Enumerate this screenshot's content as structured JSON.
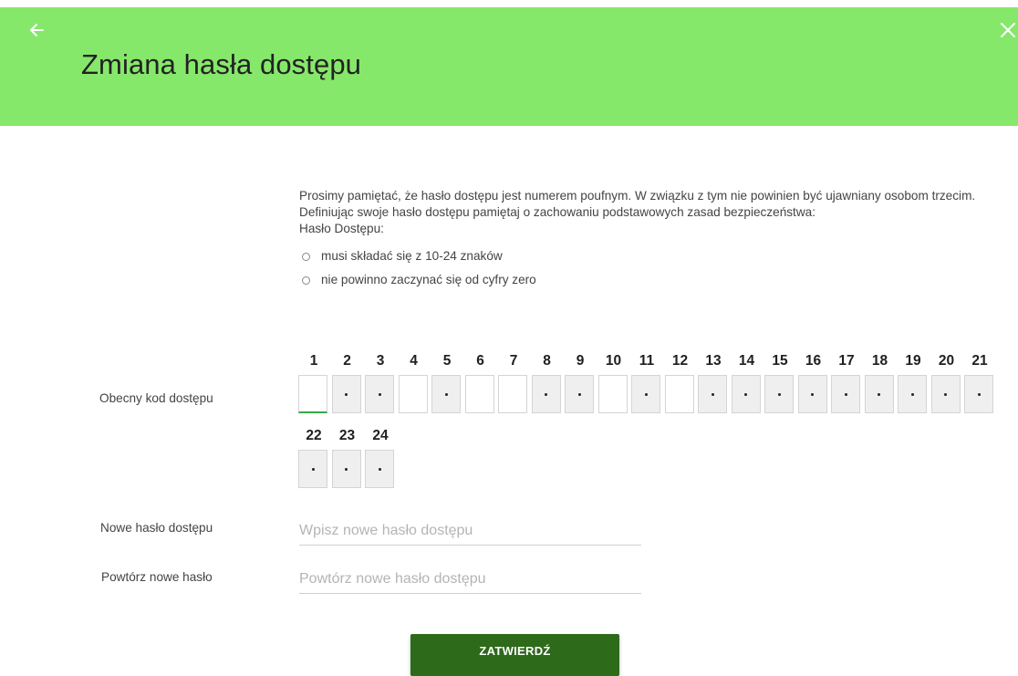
{
  "header": {
    "title": "Zmiana hasła dostępu",
    "back_icon": "arrow-left-icon",
    "close_icon": "close-icon",
    "background_color": "#86e86a"
  },
  "info": {
    "paragraph1": "Prosimy pamiętać, że hasło dostępu jest numerem poufnym. W związku z tym nie powinien być ujawniany osobom trzecim.",
    "paragraph2": "Definiując swoje hasło dostępu pamiętaj o zachowaniu podstawowych zasad bezpieczeństwa:",
    "paragraph3": "Hasło Dostępu:",
    "rules": [
      "musi składać się z 10-24 znaków",
      "nie powinno zaczynać się od cyfry zero"
    ]
  },
  "current_code": {
    "label": "Obecny kod dostępu",
    "positions": [
      {
        "num": "1",
        "state": "active"
      },
      {
        "num": "2",
        "state": "disabled"
      },
      {
        "num": "3",
        "state": "disabled"
      },
      {
        "num": "4",
        "state": "enabled"
      },
      {
        "num": "5",
        "state": "disabled"
      },
      {
        "num": "6",
        "state": "enabled"
      },
      {
        "num": "7",
        "state": "enabled"
      },
      {
        "num": "8",
        "state": "disabled"
      },
      {
        "num": "9",
        "state": "disabled"
      },
      {
        "num": "10",
        "state": "enabled"
      },
      {
        "num": "11",
        "state": "disabled"
      },
      {
        "num": "12",
        "state": "enabled"
      },
      {
        "num": "13",
        "state": "disabled"
      },
      {
        "num": "14",
        "state": "disabled"
      },
      {
        "num": "15",
        "state": "disabled"
      },
      {
        "num": "16",
        "state": "disabled"
      },
      {
        "num": "17",
        "state": "disabled"
      },
      {
        "num": "18",
        "state": "disabled"
      },
      {
        "num": "19",
        "state": "disabled"
      },
      {
        "num": "20",
        "state": "disabled"
      },
      {
        "num": "21",
        "state": "disabled"
      },
      {
        "num": "22",
        "state": "disabled"
      },
      {
        "num": "23",
        "state": "disabled"
      },
      {
        "num": "24",
        "state": "disabled"
      }
    ]
  },
  "new_password": {
    "label": "Nowe hasło dostępu",
    "placeholder": "Wpisz nowe hasło dostępu",
    "value": ""
  },
  "repeat_password": {
    "label": "Powtórz nowe hasło",
    "placeholder": "Powtórz nowe hasło dostępu",
    "value": ""
  },
  "submit": {
    "label": "ZATWIERDŹ",
    "color": "#2d6a1a"
  }
}
